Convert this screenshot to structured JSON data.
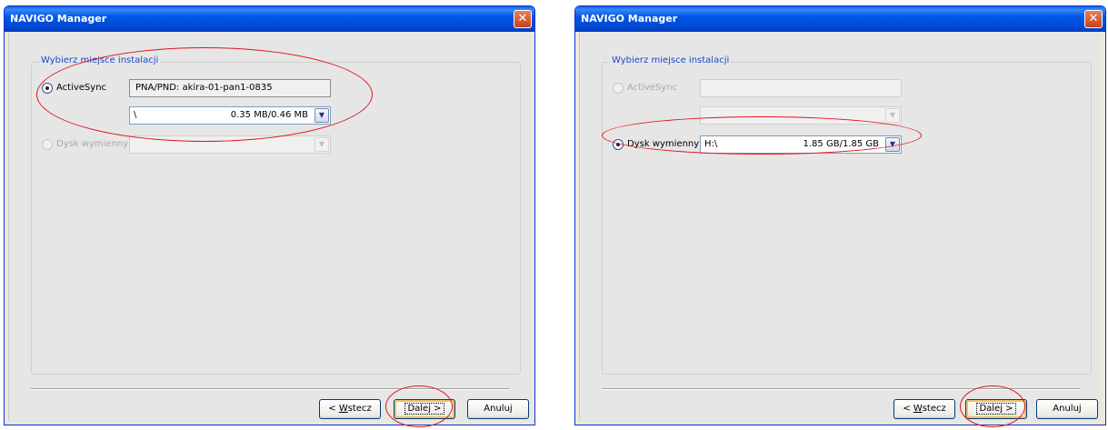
{
  "accent_color": "#0058E6",
  "annotation_color": "#E0141E",
  "windows": [
    {
      "title": "NAVIGO Manager",
      "group_title": "Wybierz miejsce instalacji",
      "activesync": {
        "label": "ActiveSync",
        "device": "PNA/PND: akira-01-pan1-0835",
        "path": "\\",
        "size": "0.35 MB/0.46 MB"
      },
      "removable": {
        "label": "Dysk wymienny",
        "path": "",
        "size": ""
      },
      "buttons": {
        "back_prefix": "< ",
        "back_key": "W",
        "back_rest": "stecz",
        "next": "Dalej >",
        "cancel": "Anuluj"
      }
    },
    {
      "title": "NAVIGO Manager",
      "group_title": "Wybierz miejsce instalacji",
      "activesync": {
        "label": "ActiveSync",
        "device": "",
        "path": "",
        "size": ""
      },
      "removable": {
        "label": "Dysk wymienny",
        "path": "H:\\",
        "size": "1.85 GB/1.85 GB"
      },
      "buttons": {
        "back_prefix": "< ",
        "back_key": "W",
        "back_rest": "stecz",
        "next": "Dalej >",
        "cancel": "Anuluj"
      }
    }
  ]
}
